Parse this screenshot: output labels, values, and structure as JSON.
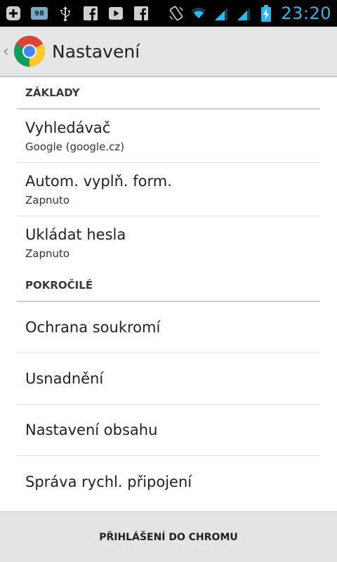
{
  "status_bar": {
    "time": "23:20",
    "notification_count": "98",
    "icons": [
      "add-icon",
      "notification-badge-icon",
      "usb-icon",
      "facebook-icon",
      "youtube-icon",
      "facebook-icon",
      "screen-rotation-icon",
      "wifi-icon",
      "signal-icon",
      "signal-icon",
      "battery-charging-icon"
    ],
    "time_color": "#33b5e5"
  },
  "action_bar": {
    "title": "Nastavení",
    "icon": "chrome-icon",
    "up_icon": "back-caret-icon"
  },
  "sections": [
    {
      "header": "ZÁKLADY",
      "items": [
        {
          "title": "Vyhledávač",
          "summary": "Google (google.cz)"
        },
        {
          "title": "Autom. vyplň. form.",
          "summary": "Zapnuto"
        },
        {
          "title": "Ukládat hesla",
          "summary": "Zapnuto"
        }
      ]
    },
    {
      "header": "POKROČILÉ",
      "items": [
        {
          "title": "Ochrana soukromí"
        },
        {
          "title": "Usnadnění"
        },
        {
          "title": "Nastavení obsahu"
        },
        {
          "title": "Správa rychl. připojení"
        }
      ]
    }
  ],
  "bottom_bar": {
    "button_label": "PŘIHLÁŠENÍ DO CHROMU"
  }
}
